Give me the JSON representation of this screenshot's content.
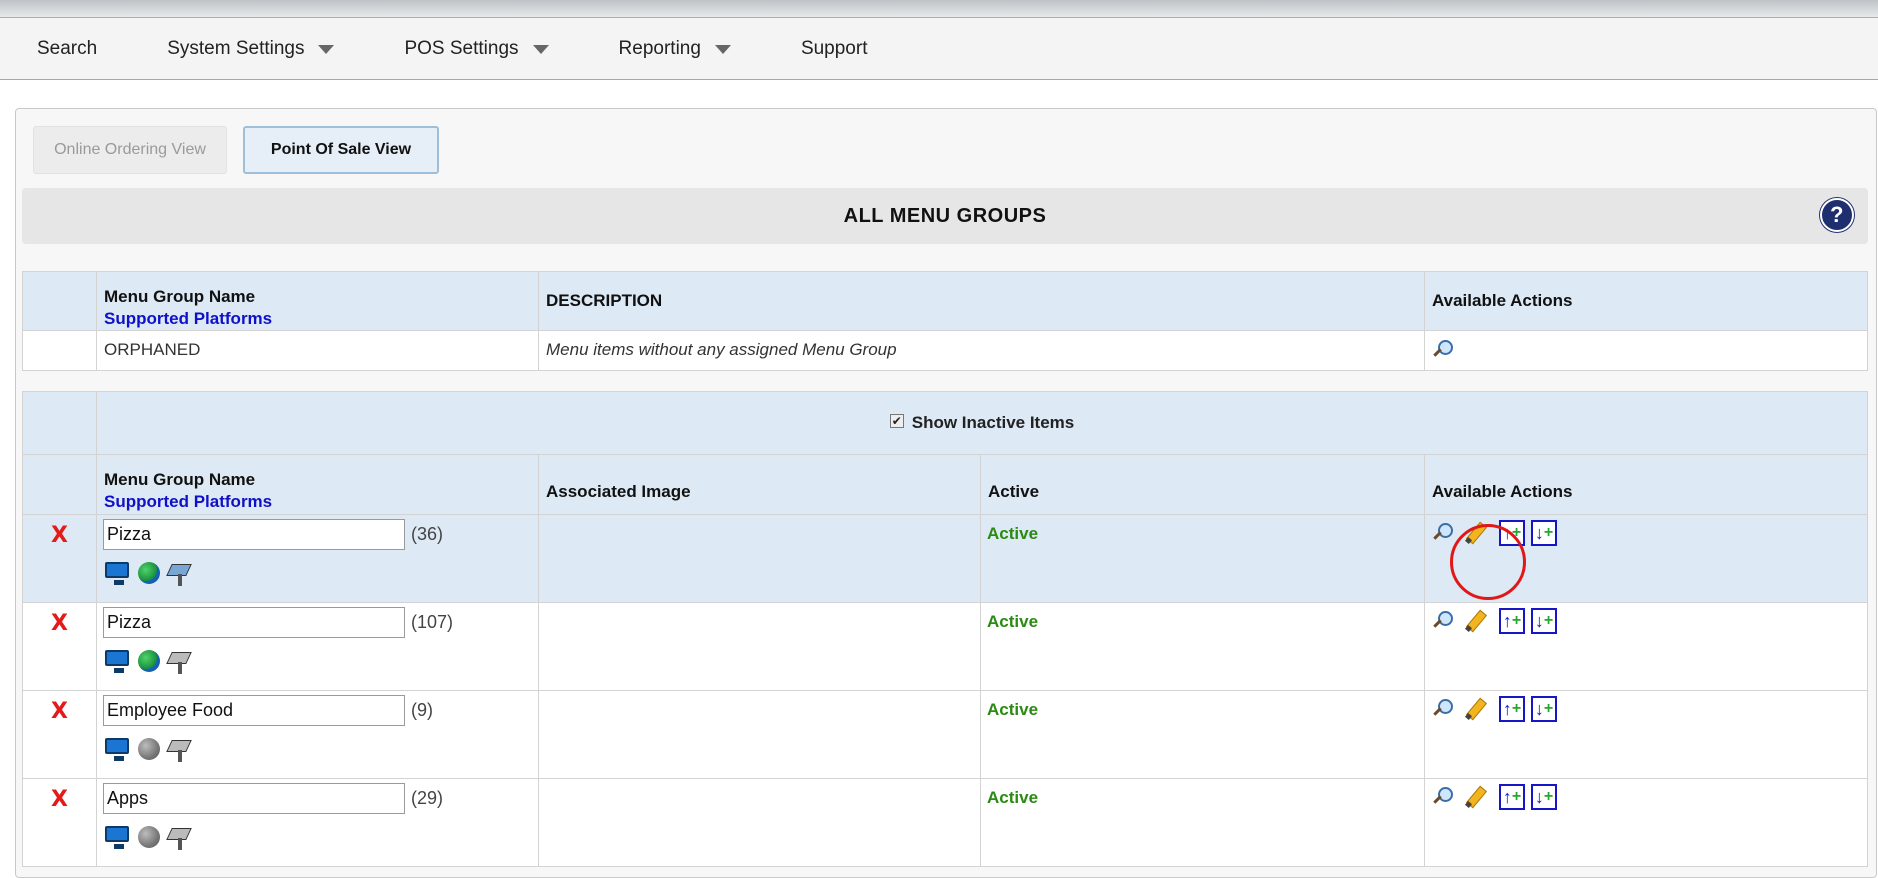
{
  "nav": {
    "search": "Search",
    "system_settings": "System Settings",
    "pos_settings": "POS Settings",
    "reporting": "Reporting",
    "support": "Support"
  },
  "tabs": {
    "online_ordering": "Online Ordering View",
    "point_of_sale": "Point Of Sale View"
  },
  "page_title": "ALL MENU GROUPS",
  "help_label": "?",
  "orphan_table": {
    "headers": {
      "name": "Menu Group Name",
      "platforms": "Supported Platforms",
      "description": "DESCRIPTION",
      "actions": "Available Actions"
    },
    "row": {
      "name": "ORPHANED",
      "description": "Menu items without any assigned Menu Group"
    }
  },
  "groups_table": {
    "show_inactive_label": "Show Inactive Items",
    "show_inactive_checked": true,
    "headers": {
      "name": "Menu Group Name",
      "platforms": "Supported Platforms",
      "image": "Associated Image",
      "active": "Active",
      "actions": "Available Actions"
    },
    "delete_glyph": "X",
    "rows": [
      {
        "name": "Pizza",
        "count": "(36)",
        "status": "Active",
        "web_enabled": true,
        "kiosk_enabled": true,
        "selected": true
      },
      {
        "name": "Pizza",
        "count": "(107)",
        "status": "Active",
        "web_enabled": true,
        "kiosk_enabled": false,
        "selected": false
      },
      {
        "name": "Employee Food",
        "count": "(9)",
        "status": "Active",
        "web_enabled": false,
        "kiosk_enabled": false,
        "selected": false
      },
      {
        "name": "Apps",
        "count": "(29)",
        "status": "Active",
        "web_enabled": false,
        "kiosk_enabled": false,
        "selected": false
      }
    ]
  },
  "colors": {
    "header_bg": "#dde9f4",
    "active_green": "#2b8a12",
    "delete_red": "#e41b1b",
    "platform_blue": "#1010c8",
    "annotation_red": "#e01818"
  }
}
